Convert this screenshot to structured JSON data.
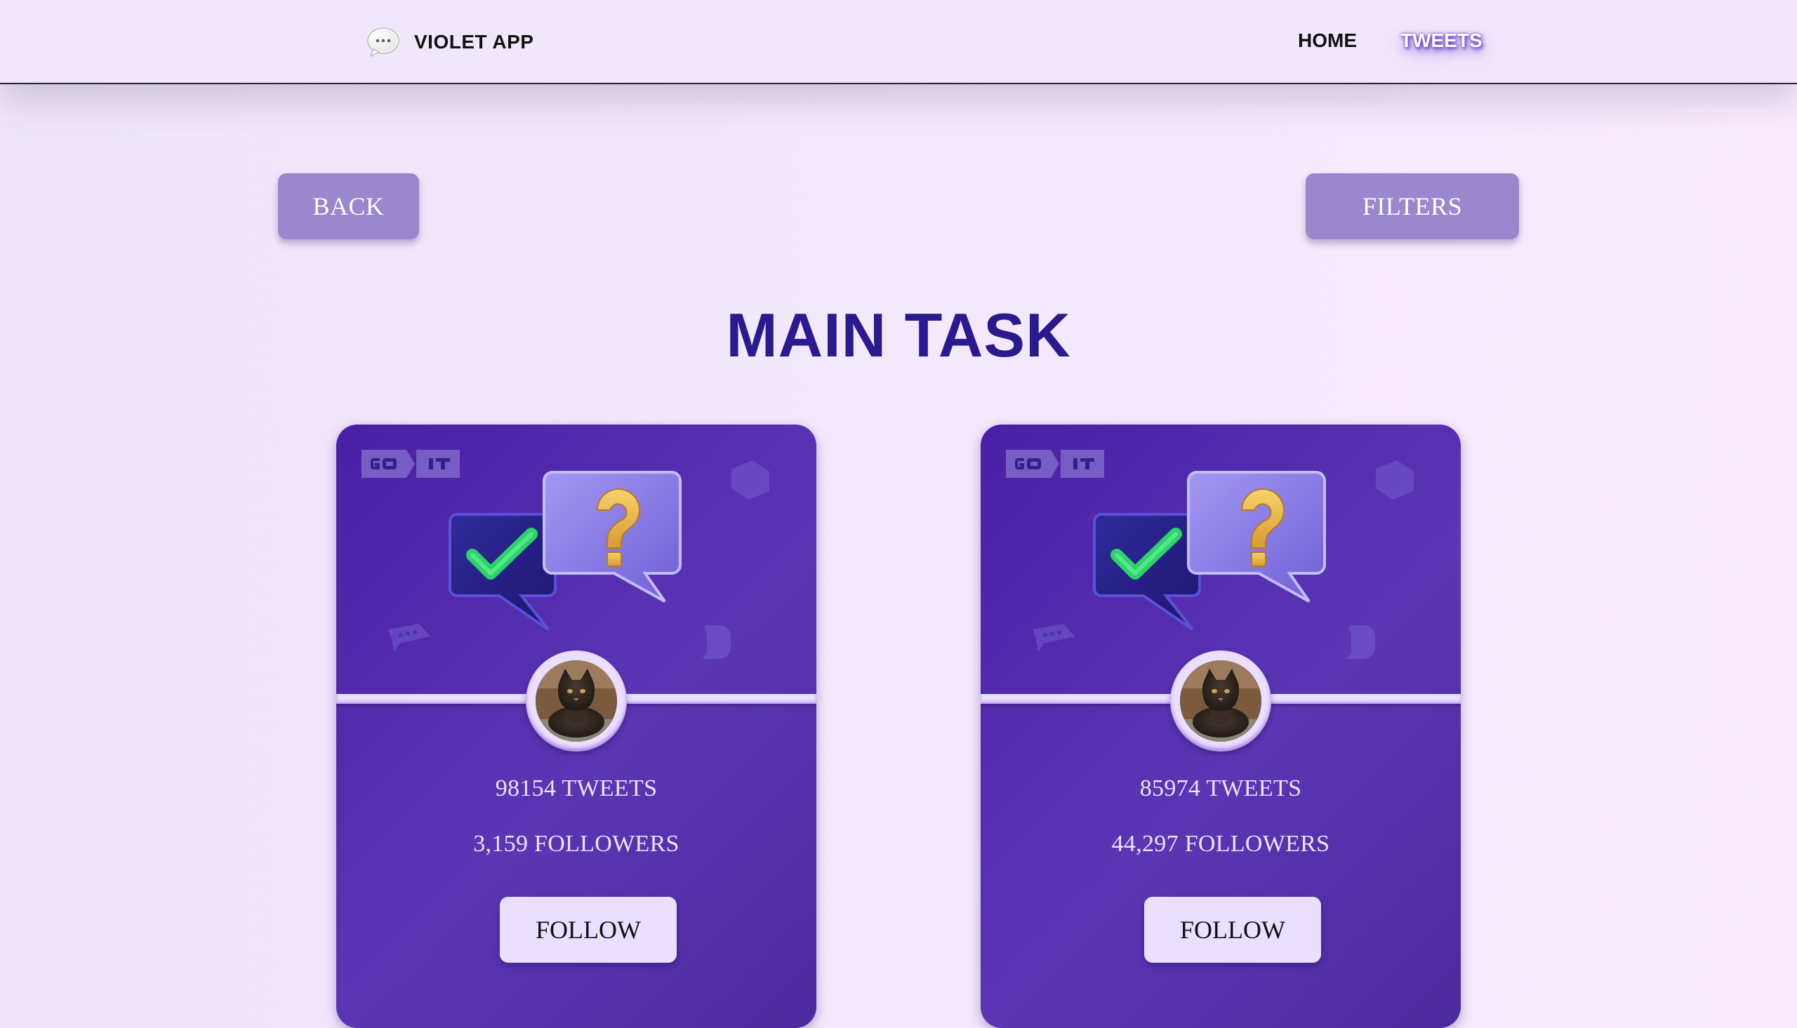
{
  "header": {
    "app_name": "VIOLET APP",
    "logo_icon": "chat-bubble-icon",
    "nav": [
      {
        "label": "HOME",
        "active": false
      },
      {
        "label": "TWEETS",
        "active": true
      }
    ]
  },
  "actions": {
    "back_label": "BACK",
    "filters_label": "FILTERS"
  },
  "page": {
    "title": "MAIN TASK"
  },
  "cards": [
    {
      "brand_logo": "goit-logo",
      "illustration": "chat-check-question-icon",
      "avatar": "cat-avatar",
      "tweets": "98154 TWEETS",
      "followers": "3,159 FOLLOWERS",
      "follow_label": "FOLLOW"
    },
    {
      "brand_logo": "goit-logo",
      "illustration": "chat-check-question-icon",
      "avatar": "cat-avatar",
      "tweets": "85974 TWEETS",
      "followers": "44,297 FOLLOWERS",
      "follow_label": "FOLLOW"
    }
  ],
  "colors": {
    "page_bg": "#f1e7fc",
    "card_bg": "#4a1fa6",
    "action_button": "#9a87cd",
    "follow_button": "#ebdfff",
    "title": "#2a1a8f"
  }
}
